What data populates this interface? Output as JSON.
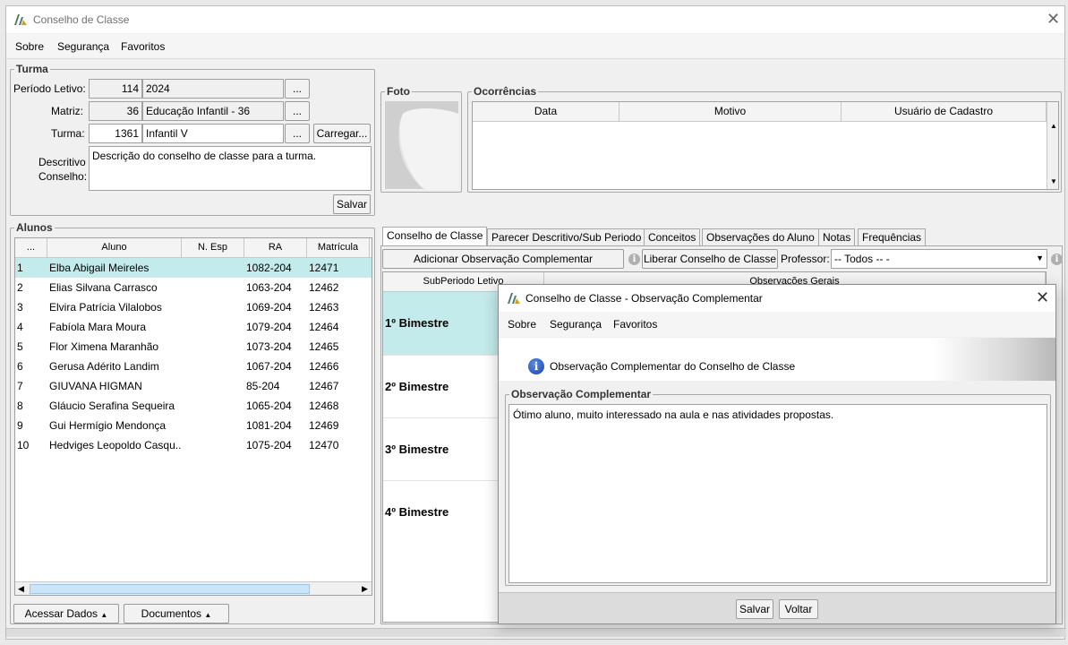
{
  "window": {
    "title": "Conselho de Classe",
    "menu": [
      "Sobre",
      "Segurança",
      "Favoritos"
    ]
  },
  "turma": {
    "legend": "Turma",
    "periodo_label": "Período Letivo:",
    "periodo_code": "114",
    "periodo_value": "2024",
    "matriz_label": "Matriz:",
    "matriz_code": "36",
    "matriz_value": "Educação Infantil - 36",
    "turma_label": "Turma:",
    "turma_code": "1361",
    "turma_value": "Infantil V",
    "lookup_label": "...",
    "carregar_label": "Carregar...",
    "descritivo_label_1": "Descritivo",
    "descritivo_label_2": "Conselho:",
    "descritivo_value": "Descrição do conselho de classe para a turma.",
    "salvar_label": "Salvar"
  },
  "foto": {
    "legend": "Foto"
  },
  "ocorrencias": {
    "legend": "Ocorrências",
    "columns": [
      "Data",
      "Motivo",
      "Usuário de Cadastro"
    ]
  },
  "alunos": {
    "legend": "Alunos",
    "columns": [
      "...",
      "Aluno",
      "N. Esp",
      "RA",
      "Matrícula"
    ],
    "rows": [
      {
        "n": "1",
        "nome": "Elba Abigail Meireles",
        "esp": "",
        "ra": "1082-204",
        "mat": "12471"
      },
      {
        "n": "2",
        "nome": "Elias Silvana Carrasco",
        "esp": "",
        "ra": "1063-204",
        "mat": "12462"
      },
      {
        "n": "3",
        "nome": "Elvira Patrícia Vilalobos",
        "esp": "",
        "ra": "1069-204",
        "mat": "12463"
      },
      {
        "n": "4",
        "nome": "Fabíola Mara Moura",
        "esp": "",
        "ra": "1079-204",
        "mat": "12464"
      },
      {
        "n": "5",
        "nome": "Flor Ximena Maranhão",
        "esp": "",
        "ra": "1073-204",
        "mat": "12465"
      },
      {
        "n": "6",
        "nome": "Gerusa Adérito Landim",
        "esp": "",
        "ra": "1067-204",
        "mat": "12466"
      },
      {
        "n": "7",
        "nome": "GIUVANA HIGMAN",
        "esp": "",
        "ra": "85-204",
        "mat": "12467"
      },
      {
        "n": "8",
        "nome": "Gláucio Serafina Sequeira",
        "esp": "",
        "ra": "1065-204",
        "mat": "12468"
      },
      {
        "n": "9",
        "nome": "Gui Hermígio Mendonça",
        "esp": "",
        "ra": "1081-204",
        "mat": "12469"
      },
      {
        "n": "10",
        "nome": "Hedviges Leopoldo Casqu...",
        "esp": "",
        "ra": "1075-204",
        "mat": "12470"
      }
    ],
    "acessar_label": "Acessar Dados",
    "documentos_label": "Documentos"
  },
  "tabs": [
    "Conselho de Classe",
    "Parecer Descritivo/Sub Periodo",
    "Conceitos",
    "Observações do Aluno",
    "Notas",
    "Frequências"
  ],
  "conselho": {
    "add_obs_label": "Adicionar Observação Complementar",
    "liberar_label": "Liberar Conselho de Classe",
    "professor_label": "Professor:",
    "professor_value": "-- Todos -- -",
    "columns": [
      "SubPeriodo Letivo",
      "Observações Gerais"
    ],
    "periods": [
      "1º Bimestre",
      "2º Bimestre",
      "3º Bimestre",
      "4º Bimestre"
    ]
  },
  "dialog": {
    "title": "Conselho de Classe - Observação Complementar",
    "menu": [
      "Sobre",
      "Segurança",
      "Favoritos"
    ],
    "header_text": "Observação Complementar do Conselho de Classe",
    "legend": "Observação Complementar",
    "text": "Ótimo aluno, muito interessado na aula e nas atividades propostas.",
    "salvar_label": "Salvar",
    "voltar_label": "Voltar"
  },
  "colors": {
    "selected_row": "#c4ebeb",
    "accent": "#1b3fa5"
  }
}
